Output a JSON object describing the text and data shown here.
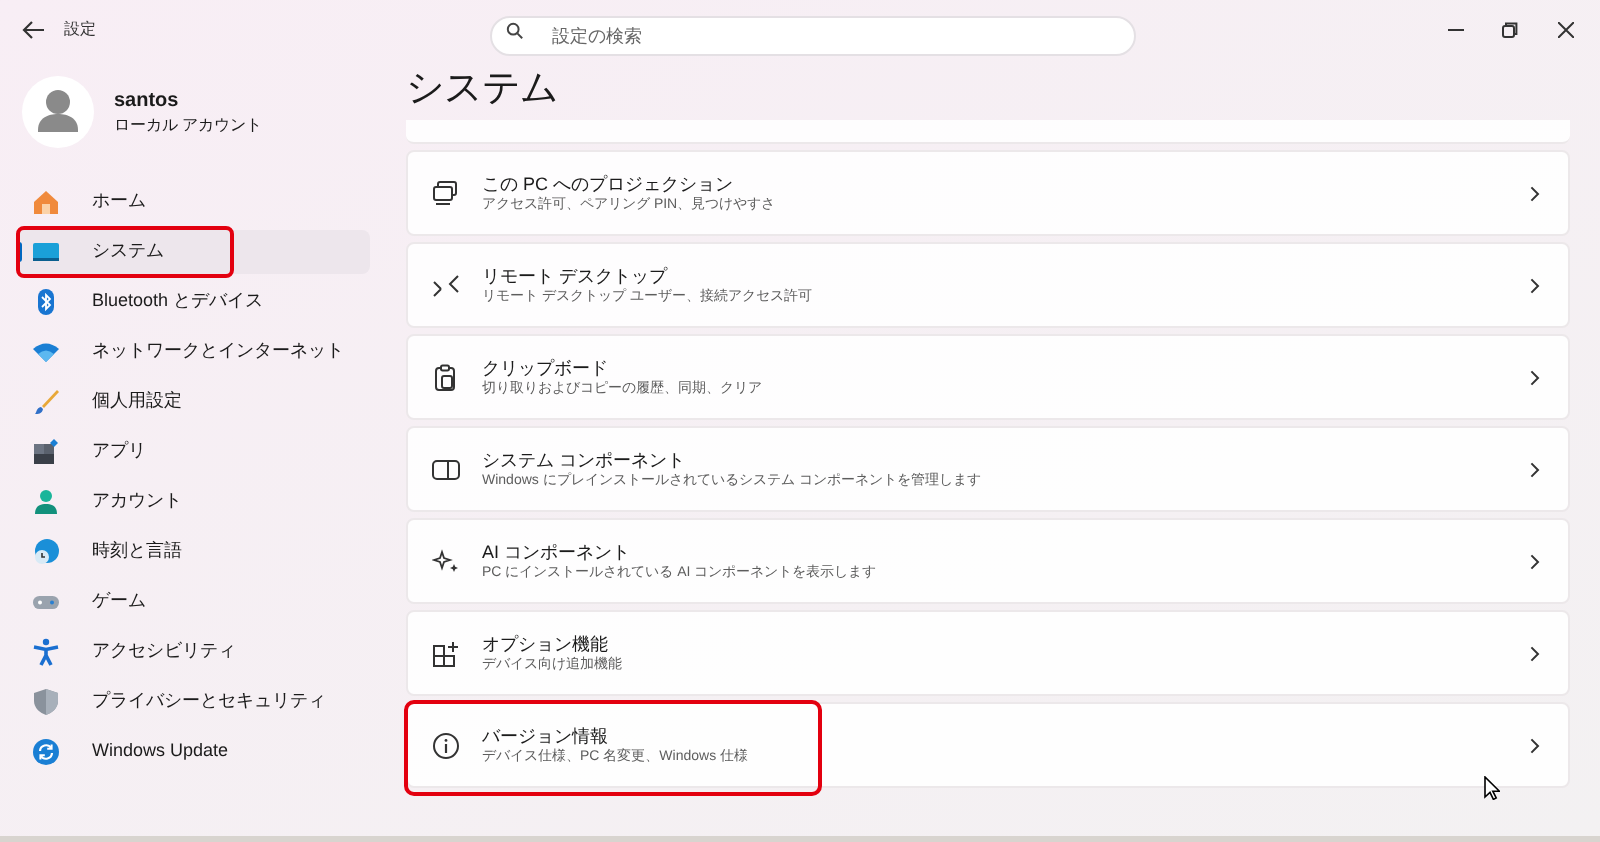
{
  "window": {
    "title": "設定"
  },
  "search": {
    "placeholder": "設定の検索"
  },
  "user": {
    "name": "santos",
    "account": "ローカル アカウント"
  },
  "nav": [
    {
      "label": "ホーム",
      "selected": false,
      "highlighted": false
    },
    {
      "label": "システム",
      "selected": true,
      "highlighted": true
    },
    {
      "label": "Bluetooth とデバイス",
      "selected": false,
      "highlighted": false
    },
    {
      "label": "ネットワークとインターネット",
      "selected": false,
      "highlighted": false
    },
    {
      "label": "個人用設定",
      "selected": false,
      "highlighted": false
    },
    {
      "label": "アプリ",
      "selected": false,
      "highlighted": false
    },
    {
      "label": "アカウント",
      "selected": false,
      "highlighted": false
    },
    {
      "label": "時刻と言語",
      "selected": false,
      "highlighted": false
    },
    {
      "label": "ゲーム",
      "selected": false,
      "highlighted": false
    },
    {
      "label": "アクセシビリティ",
      "selected": false,
      "highlighted": false
    },
    {
      "label": "プライバシーとセキュリティ",
      "selected": false,
      "highlighted": false
    },
    {
      "label": "Windows Update",
      "selected": false,
      "highlighted": false
    }
  ],
  "page_title": "システム",
  "settings": [
    {
      "title": "この PC へのプロジェクション",
      "description": "アクセス許可、ペアリング PIN、見つけやすさ",
      "highlighted": false
    },
    {
      "title": "リモート デスクトップ",
      "description": "リモート デスクトップ ユーザー、接続アクセス許可",
      "highlighted": false
    },
    {
      "title": "クリップボード",
      "description": "切り取りおよびコピーの履歴、同期、クリア",
      "highlighted": false
    },
    {
      "title": "システム コンポーネント",
      "description": "Windows にプレインストールされているシステム コンポーネントを管理します",
      "highlighted": false
    },
    {
      "title": "AI コンポーネント",
      "description": "PC にインストールされている AI コンポーネントを表示します",
      "highlighted": false
    },
    {
      "title": "オプション機能",
      "description": "デバイス向け追加機能",
      "highlighted": false
    },
    {
      "title": "バージョン情報",
      "description": "デバイス仕様、PC 名変更、Windows 仕様",
      "highlighted": true
    }
  ]
}
